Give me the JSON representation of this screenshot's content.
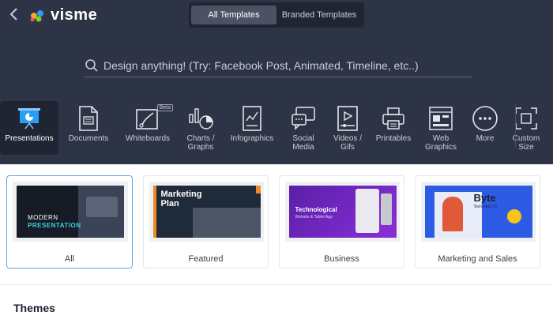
{
  "header": {
    "logo_text": "visme",
    "toggle": {
      "active": "All Templates",
      "inactive": "Branded Templates"
    }
  },
  "search": {
    "placeholder": "Design anything! (Try: Facebook Post, Animated, Timeline, etc..)"
  },
  "categories": [
    {
      "label": "Presentations",
      "icon": "presentation-icon"
    },
    {
      "label": "Documents",
      "icon": "document-icon"
    },
    {
      "label": "Whiteboards",
      "icon": "whiteboard-icon",
      "badge": "Beta"
    },
    {
      "label": "Charts /\nGraphs",
      "icon": "chart-icon"
    },
    {
      "label": "Infographics",
      "icon": "infographic-icon"
    },
    {
      "label": "Social\nMedia",
      "icon": "social-media-icon"
    },
    {
      "label": "Videos /\nGifs",
      "icon": "video-icon"
    },
    {
      "label": "Printables",
      "icon": "printer-icon"
    },
    {
      "label": "Web\nGraphics",
      "icon": "web-graphics-icon"
    },
    {
      "label": "More",
      "icon": "more-icon"
    },
    {
      "label": "Custom\nSize",
      "icon": "custom-size-icon"
    }
  ],
  "cards": [
    {
      "label": "All",
      "thumb_title": "MODERN",
      "thumb_sub": "PRESENTATION"
    },
    {
      "label": "Featured",
      "thumb_title": "Marketing",
      "thumb_sub": "Plan"
    },
    {
      "label": "Business",
      "thumb_title": "Technological",
      "thumb_sub": "Website & Tablet App"
    },
    {
      "label": "Marketing and Sales",
      "thumb_title": "Byte",
      "thumb_sub": "Tech Fest 7.0"
    }
  ],
  "themes": {
    "heading": "Themes"
  },
  "colors": {
    "header_bg": "#2d3445",
    "accent": "#2a9df4",
    "selected_border": "#5ba6e6"
  }
}
